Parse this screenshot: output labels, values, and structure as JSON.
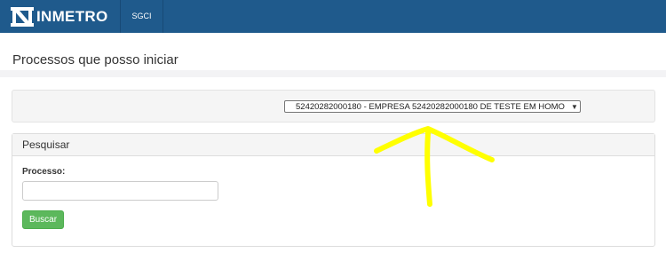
{
  "navbar": {
    "brand": "INMETRO",
    "items": [
      {
        "label": "SGCI"
      }
    ],
    "background": "#1f5a8c"
  },
  "page": {
    "title": "Processos que posso iniciar"
  },
  "company_select": {
    "selected": "52420282000180 - EMPRESA 52420282000180 DE TESTE EM HOMO"
  },
  "search_panel": {
    "heading": "Pesquisar",
    "process_label": "Processo:",
    "process_value": "",
    "button_label": "Buscar",
    "button_color": "#5cb85c"
  },
  "annotation": {
    "shape": "hand-drawn-arrow",
    "color": "#ffff00"
  }
}
